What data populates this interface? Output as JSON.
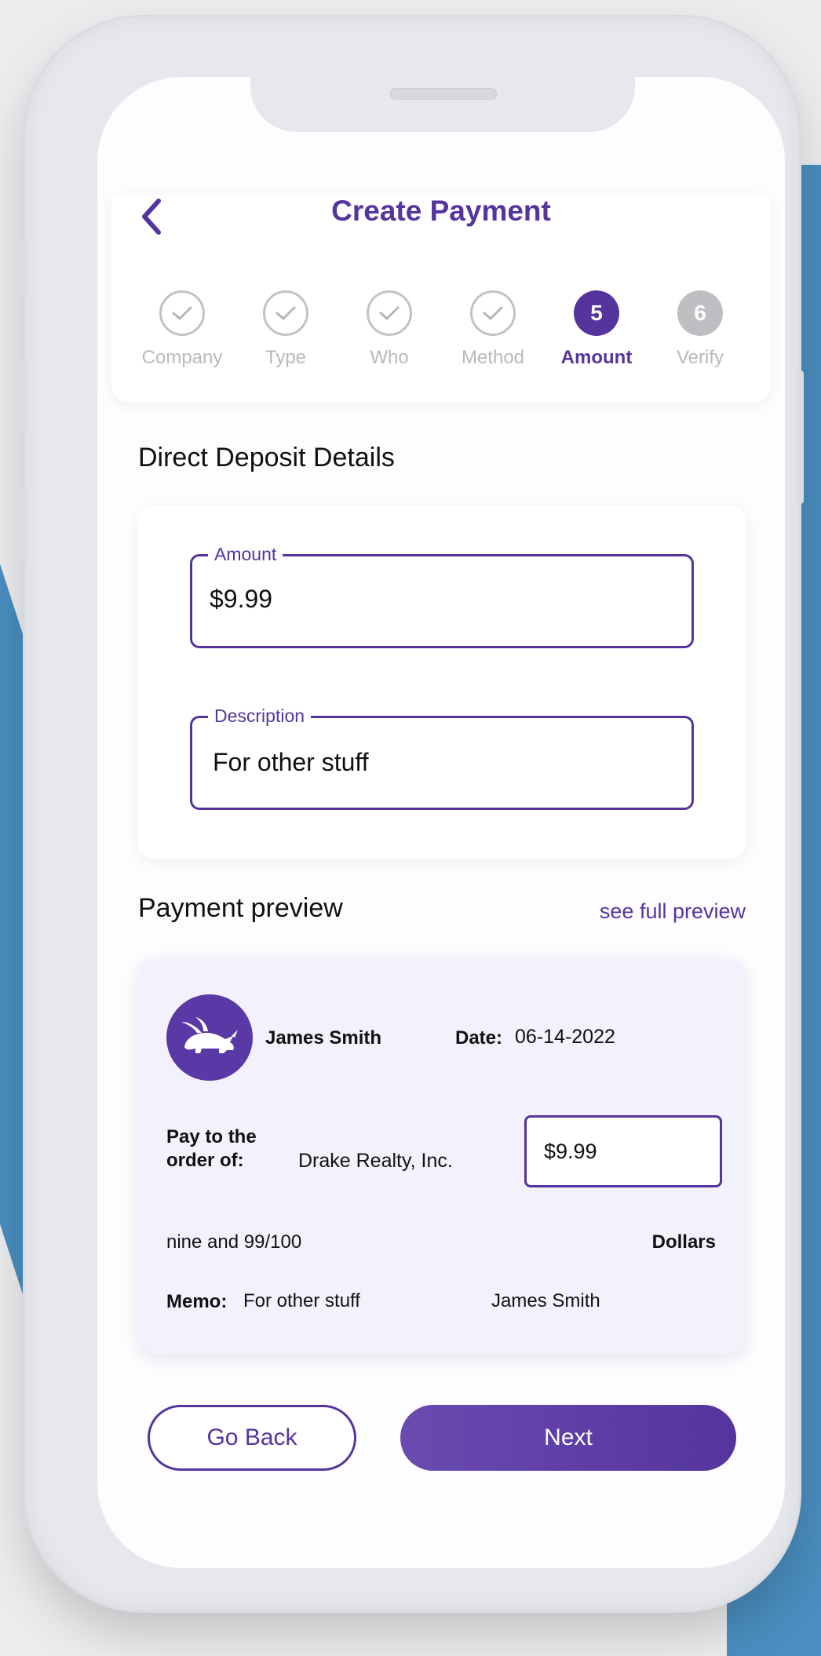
{
  "header": {
    "title": "Create Payment",
    "back_icon": "chevron-left-icon"
  },
  "steps": [
    {
      "label": "Company",
      "state": "done",
      "number": ""
    },
    {
      "label": "Type",
      "state": "done",
      "number": ""
    },
    {
      "label": "Who",
      "state": "done",
      "number": ""
    },
    {
      "label": "Method",
      "state": "done",
      "number": ""
    },
    {
      "label": "Amount",
      "state": "active",
      "number": "5"
    },
    {
      "label": "Verify",
      "state": "pending",
      "number": "6"
    }
  ],
  "details": {
    "title": "Direct Deposit Details",
    "amount_label": "Amount",
    "amount_value": "$9.99",
    "description_label": "Description",
    "description_value": "For other stuff"
  },
  "preview": {
    "title": "Payment preview",
    "see_full_link": "see full preview",
    "payer_name": "James Smith",
    "date_label": "Date:",
    "date_value": "06-14-2022",
    "pay_to_label_line1": "Pay to the",
    "pay_to_label_line2": "order of:",
    "payee": "Drake Realty, Inc.",
    "amount": "$9.99",
    "amount_words": "nine and 99/100",
    "dollars_label": "Dollars",
    "memo_label": "Memo:",
    "memo_value": "For other stuff",
    "signature": "James Smith"
  },
  "buttons": {
    "go_back": "Go Back",
    "next": "Next"
  },
  "colors": {
    "accent": "#55349e",
    "inactive": "#bebec2",
    "preview_bg": "#f3f1fb",
    "side_blue": "#4a8dbe"
  }
}
